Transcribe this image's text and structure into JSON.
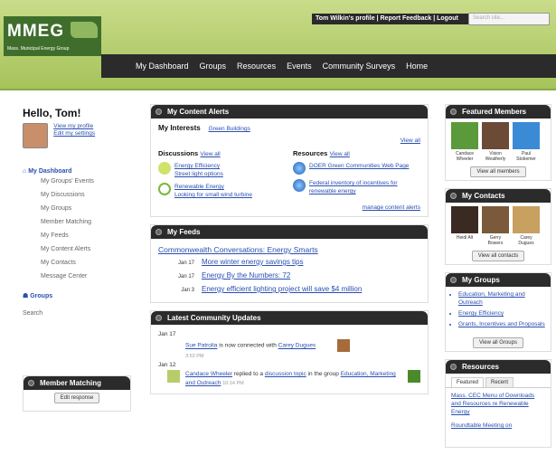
{
  "header": {
    "logo_text": "MMEG",
    "logo_subtitle": "Mass. Municipal Energy Group",
    "user_links": "Tom Wilkin's profile | Report Feedback | Logout",
    "search_placeholder": "Search site..."
  },
  "nav": [
    "My Dashboard",
    "Groups",
    "Resources",
    "Events",
    "Community Surveys",
    "Home"
  ],
  "left": {
    "greeting": "Hello, Tom!",
    "profile_links": [
      "View my profile",
      "Edit my settings"
    ],
    "dashboard_label": "My Dashboard",
    "dashboard_items": [
      "My Groups' Events",
      "My Discussions",
      "My Groups",
      "Member Matching",
      "My Feeds",
      "My Content Alerts",
      "My Contacts",
      "Message Center"
    ],
    "groups_label": "Groups",
    "search_label": "Search",
    "member_matching_title": "Member Matching",
    "edit_response": "Edit response"
  },
  "content_alerts": {
    "title": "My Content Alerts",
    "interests_label": "My Interests",
    "interest": "Green Buildings",
    "view_all": "View all",
    "discussions": {
      "label": "Discussions",
      "view_all": "View all",
      "items": [
        {
          "title": "Energy Efficiency",
          "sub": "Street light options"
        },
        {
          "title": "Renewable Energy",
          "sub": "Looking for small wind turbine"
        }
      ]
    },
    "resources": {
      "label": "Resources",
      "view_all": "View all",
      "items": [
        "DOER Green Communities Web Page",
        "Federal inventory of incentives for renewable energy"
      ]
    },
    "manage": "manage content alerts"
  },
  "feeds": {
    "title": "My Feeds",
    "headline": "Commonwealth Conversations: Energy Smarts",
    "items": [
      {
        "date": "Jan 17",
        "text": "More winter energy savings tips"
      },
      {
        "date": "Jan 17",
        "text": "Energy By the Numbers: 72"
      },
      {
        "date": "Jan 3",
        "text": "Energy efficient lighting project will save $4 million"
      }
    ]
  },
  "updates": {
    "title": "Latest Community Updates",
    "d1": "Jan 17",
    "u1a": "Sue Patrolia",
    "u1b": "is now connected with",
    "u1c": "Carey Dugues",
    "t1": "3:53 PM",
    "d2": "Jan 12",
    "u2a": "Candace Wheeler",
    "u2b": "replied to a",
    "u2c": "discussion topic",
    "u2d": "in the group",
    "u2e": "Education, Marketing and Outreach",
    "t2": "10:14 PM"
  },
  "right": {
    "featured_title": "Featured Members",
    "featured": [
      "Candace Wheeler",
      "Vision Weatherly",
      "Paul Stobemer"
    ],
    "view_all_members": "View all members",
    "contacts_title": "My Contacts",
    "contacts": [
      "Heidi Alt",
      "Gerry Bowers",
      "Carey Dugues"
    ],
    "view_all_contacts": "View all contacts",
    "groups_title": "My Groups",
    "groups": [
      "Education, Marketing and Outreach",
      "Energy Efficiency",
      "Grants, Incentives and Proposals"
    ],
    "view_all_groups": "View all Groups",
    "resources_title": "Resources",
    "tabs": [
      "Featured",
      "Recent"
    ],
    "resources": [
      "Mass. CEC Menu of Downloads and Resources re Renewable Energy",
      "Roundtable Meeting on"
    ]
  }
}
